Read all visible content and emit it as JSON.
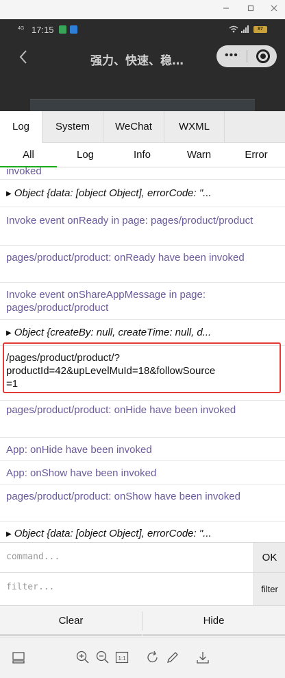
{
  "status_bar": {
    "time": "17:15",
    "network_text": "4G",
    "battery": "87"
  },
  "page": {
    "title": "强力、快速、稳…",
    "capsule_menu": "•••"
  },
  "console": {
    "tabs": [
      "Log",
      "System",
      "WeChat",
      "WXML"
    ],
    "subtabs": [
      "All",
      "Log",
      "Info",
      "Warn",
      "Error"
    ],
    "logs": [
      {
        "type": "info",
        "text": "invoked"
      },
      {
        "type": "obj",
        "text": "Object {data: [object Object], errorCode: \"..."
      },
      {
        "type": "info",
        "text": "Invoke event onReady in page: pages/product/product"
      },
      {
        "type": "info",
        "text": "pages/product/product: onReady have been invoked"
      },
      {
        "type": "info",
        "text": "Invoke event onShareAppMessage in page: pages/product/product"
      },
      {
        "type": "obj",
        "text": "Object {createBy: null, createTime: null, d..."
      },
      {
        "type": "plain",
        "text": "/pages/product/product/?\nproductId=42&upLevelMuId=18&followSource\n=1"
      },
      {
        "type": "info",
        "text": "pages/product/product: onHide have been invoked"
      },
      {
        "type": "info",
        "text": "App: onHide have been invoked"
      },
      {
        "type": "info",
        "text": "App: onShow have been invoked"
      },
      {
        "type": "info",
        "text": "pages/product/product: onShow have been invoked"
      },
      {
        "type": "obj",
        "text": "Object {data: [object Object], errorCode: \"..."
      }
    ],
    "command_placeholder": "command...",
    "command_button": "OK",
    "filter_placeholder": "filter...",
    "filter_button": "filter",
    "clear_label": "Clear",
    "hide_label": "Hide"
  },
  "toolbar": {
    "items": [
      "layout-icon",
      "zoom-in-icon",
      "zoom-out-icon",
      "actual-size-icon",
      "rotate-icon",
      "pen-icon",
      "download-icon"
    ],
    "actual_size_text": "1:1"
  },
  "colors": {
    "info_text": "#6b5a9c",
    "highlight_border": "#e53935",
    "active_subtab": "#1aad19"
  }
}
